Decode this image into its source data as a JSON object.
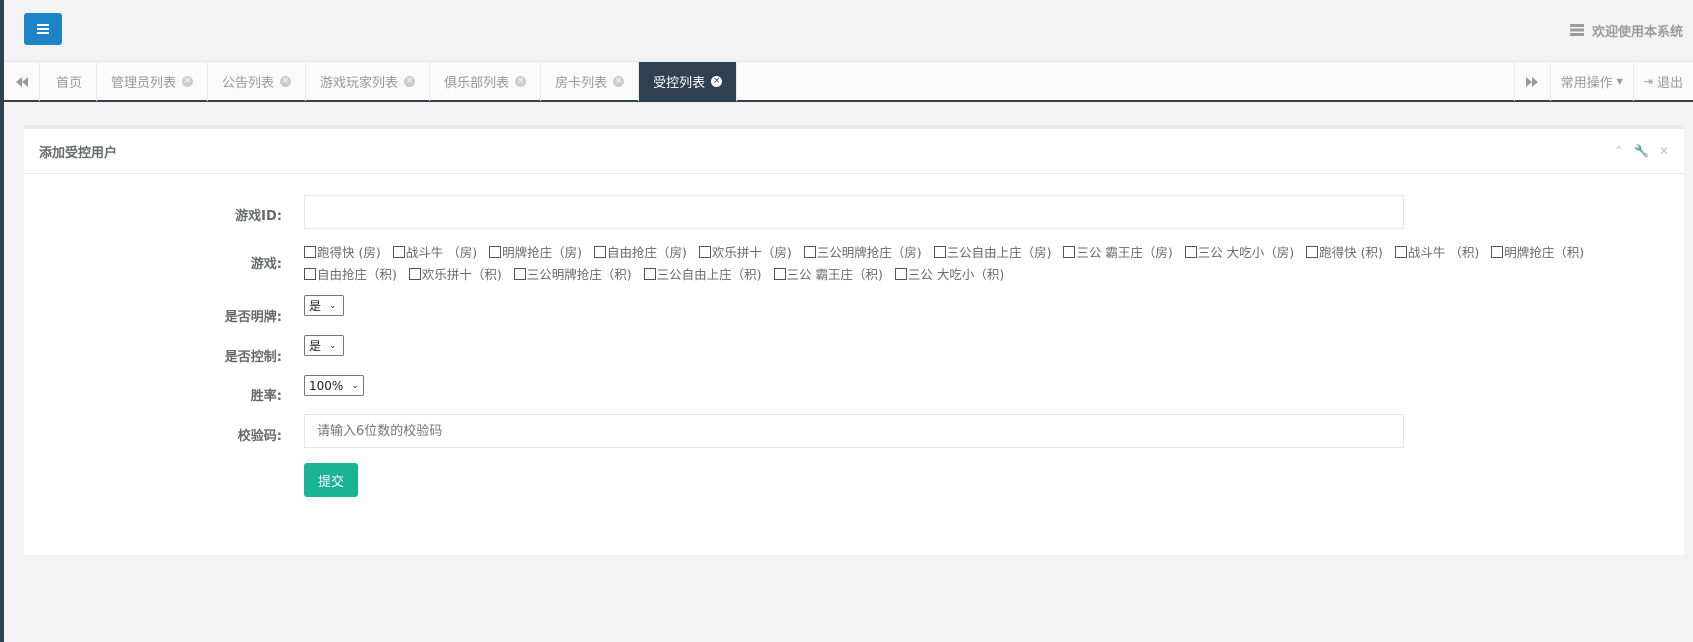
{
  "header": {
    "welcome_text": "欢迎使用本系统"
  },
  "tabs": [
    {
      "label": "首页",
      "closable": false,
      "active": false
    },
    {
      "label": "管理员列表",
      "closable": true,
      "active": false
    },
    {
      "label": "公告列表",
      "closable": true,
      "active": false
    },
    {
      "label": "游戏玩家列表",
      "closable": true,
      "active": false
    },
    {
      "label": "俱乐部列表",
      "closable": true,
      "active": false
    },
    {
      "label": "房卡列表",
      "closable": true,
      "active": false
    },
    {
      "label": "受控列表",
      "closable": true,
      "active": true
    }
  ],
  "toolbar": {
    "common_ops_label": "常用操作",
    "logout_label": "退出"
  },
  "panel": {
    "title": "添加受控用户"
  },
  "form": {
    "game_id_label": "游戏ID:",
    "game_id_value": "",
    "games_label": "游戏:",
    "games": [
      "跑得快 (房)",
      "战斗牛 （房)",
      "明牌抢庄（房)",
      "自由抢庄（房)",
      "欢乐拼十（房)",
      "三公明牌抢庄（房)",
      "三公自由上庄（房)",
      "三公 霸王庄（房)",
      "三公 大吃小（房)",
      "跑得快 (积)",
      "战斗牛 （积)",
      "明牌抢庄（积)",
      "自由抢庄（积)",
      "欢乐拼十（积)",
      "三公明牌抢庄（积)",
      "三公自由上庄（积)",
      "三公 霸王庄（积)",
      "三公 大吃小（积)"
    ],
    "show_cards_label": "是否明牌:",
    "show_cards_value": "是",
    "controlled_label": "是否控制:",
    "controlled_value": "是",
    "win_rate_label": "胜率:",
    "win_rate_value": "100%",
    "verify_label": "校验码:",
    "verify_placeholder": "请输入6位数的校验码",
    "submit_label": "提交"
  }
}
